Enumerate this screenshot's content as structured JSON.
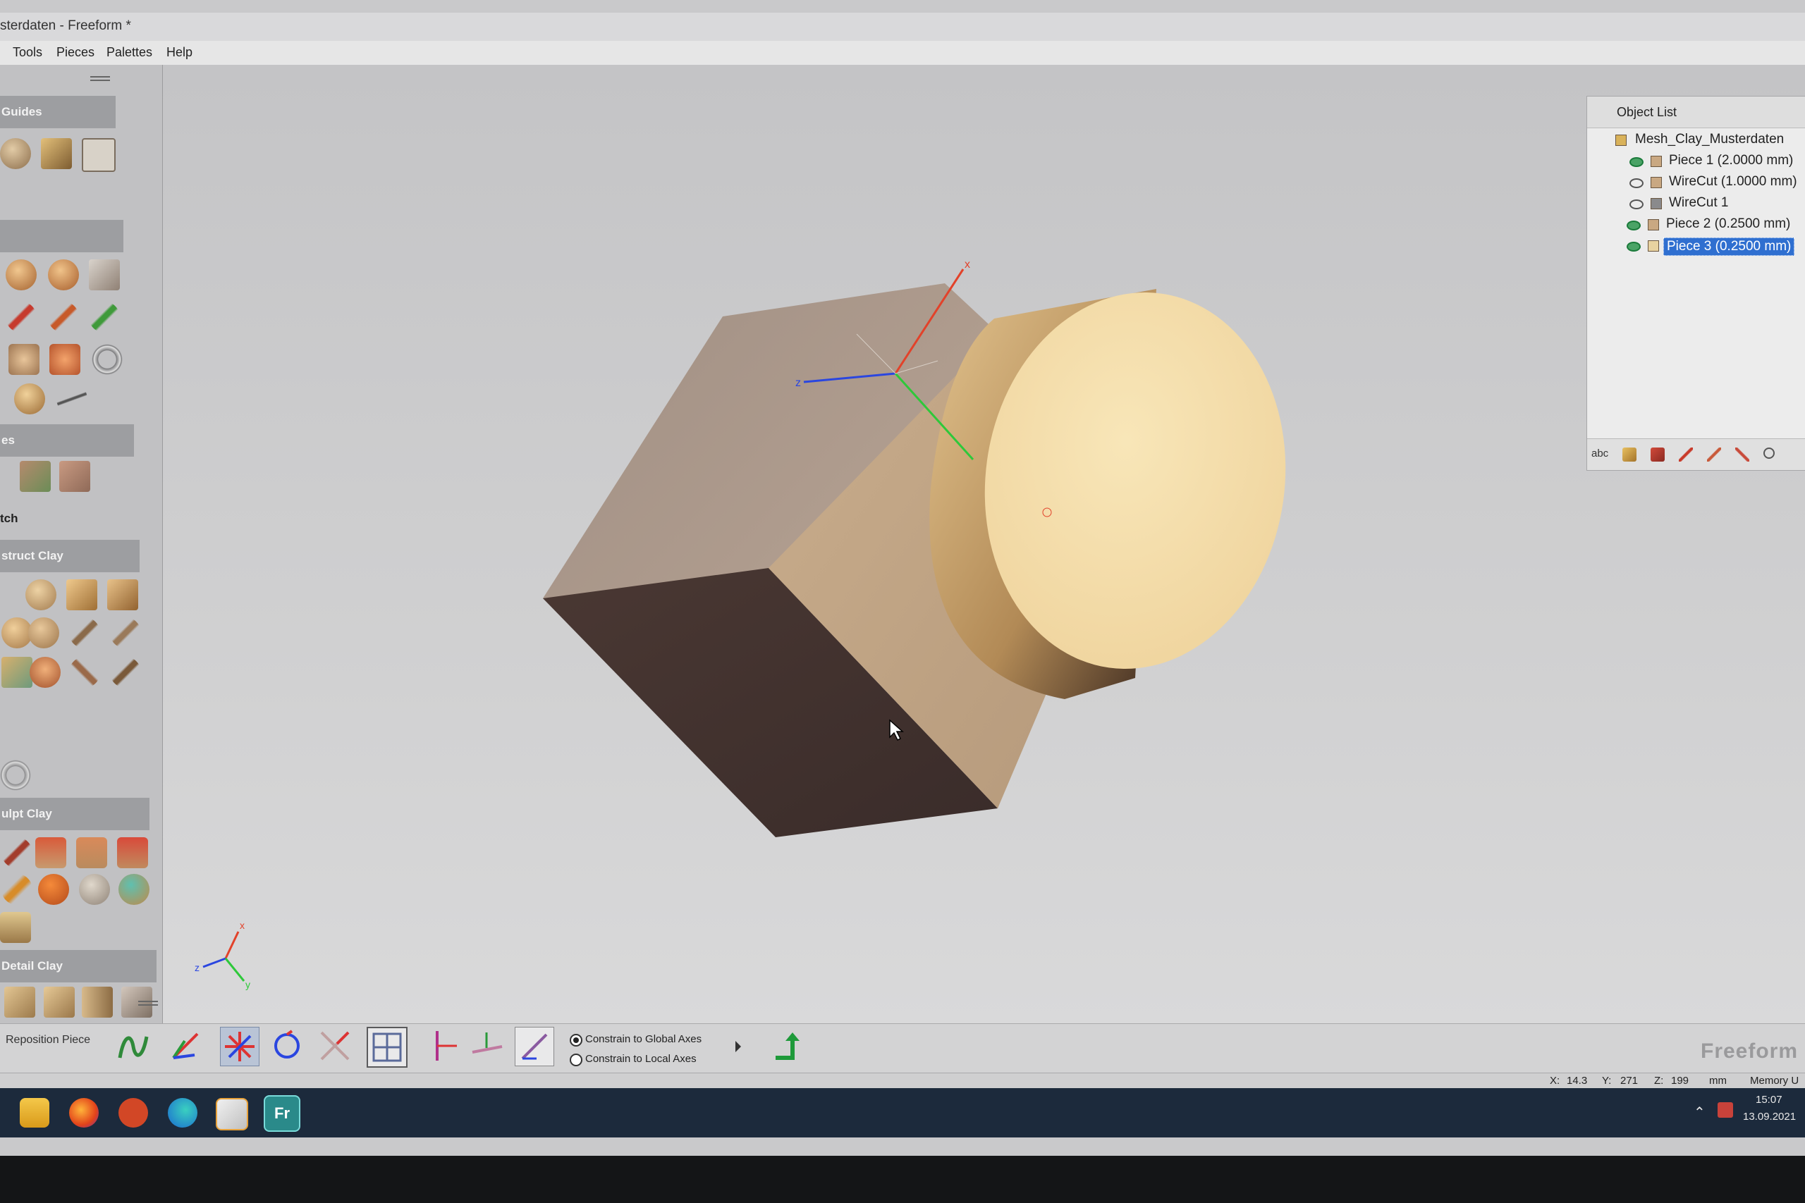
{
  "window": {
    "title": "sterdaten - Freeform *"
  },
  "menu": [
    "Tools",
    "Pieces",
    "Palettes",
    "Help"
  ],
  "palette": {
    "sections": {
      "guides": "Guides",
      "sketch": "tch",
      "truncated": "es",
      "construct": "struct Clay",
      "sculpt": "ulpt Clay",
      "detail": "Detail Clay"
    }
  },
  "object_list": {
    "title": "Object List",
    "root": "Mesh_Clay_Musterdaten",
    "items": [
      {
        "label": "Piece 1 (2.0000 mm)",
        "visible": true,
        "selected": false
      },
      {
        "label": "WireCut (1.0000 mm)",
        "visible": false,
        "selected": false
      },
      {
        "label": "WireCut 1",
        "visible": false,
        "selected": false
      },
      {
        "label": "Piece 2 (0.2500 mm)",
        "visible": true,
        "selected": false
      },
      {
        "label": "Piece 3 (0.2500 mm)",
        "visible": true,
        "selected": true
      }
    ],
    "footer_text": "abc"
  },
  "bottombar": {
    "mode_label": "Reposition Piece",
    "constrain_global": "Constrain to Global Axes",
    "constrain_local": "Constrain to Local Axes",
    "constrain_selected": "global",
    "brand": "Freeform"
  },
  "statusbar": {
    "x_label": "X:",
    "x_value": "14.3",
    "y_label": "Y:",
    "y_value": "271",
    "z_label": "Z:",
    "z_value": "199",
    "unit": "mm",
    "memory": "Memory U"
  },
  "taskbar": {
    "apps": [
      "file-explorer-icon",
      "firefox-icon",
      "powerpoint-icon",
      "edge-icon",
      "media-player-icon",
      "freeform-icon"
    ],
    "freeform_label": "Fr",
    "time": "15:07",
    "date": "13.09.2021"
  },
  "viewport": {
    "axis_labels": {
      "x": "x",
      "y": "y",
      "z": "z"
    }
  },
  "colors": {
    "selection": "#2f6fd0",
    "clay_light": "#f2dca6",
    "clay_dark": "#4a3a34",
    "axis_x": "#e2422a",
    "axis_y": "#2ec83a",
    "axis_z": "#2a46e0"
  }
}
